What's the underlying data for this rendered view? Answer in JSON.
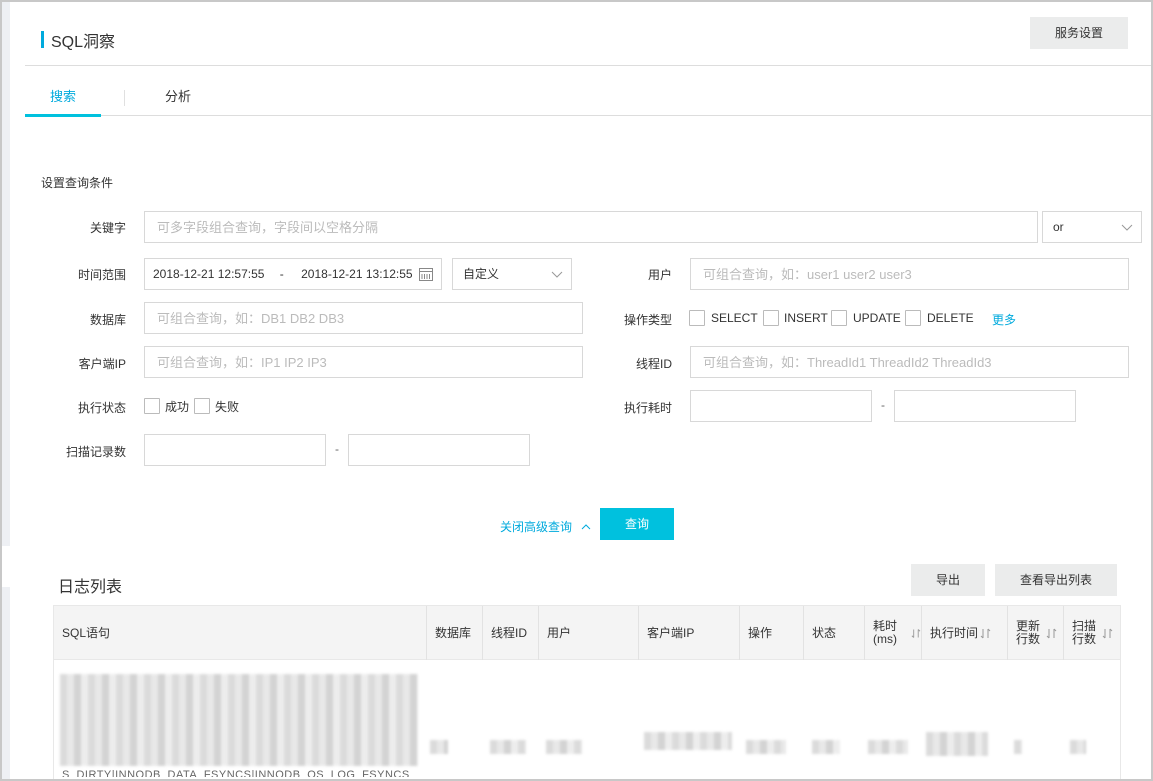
{
  "header": {
    "title": "SQL洞察",
    "service_settings_label": "服务设置"
  },
  "tabs": [
    {
      "label": "搜索",
      "active": true
    },
    {
      "label": "分析",
      "active": false
    }
  ],
  "form": {
    "section_label": "设置查询条件",
    "keyword": {
      "label": "关键字",
      "placeholder": "可多字段组合查询，字段间以空格分隔",
      "value": ""
    },
    "keyword_logic": {
      "selected": "or"
    },
    "time_range": {
      "label": "时间范围",
      "start": "2018-12-21 12:57:55",
      "separator": "-",
      "end": "2018-12-21 13:12:55",
      "preset": "自定义"
    },
    "user": {
      "label": "用户",
      "placeholder": "可组合查询，如：user1 user2 user3",
      "value": ""
    },
    "database": {
      "label": "数据库",
      "placeholder": "可组合查询，如：DB1 DB2 DB3",
      "value": ""
    },
    "operation_type": {
      "label": "操作类型",
      "options": [
        {
          "label": "SELECT",
          "checked": false
        },
        {
          "label": "INSERT",
          "checked": false
        },
        {
          "label": "UPDATE",
          "checked": false
        },
        {
          "label": "DELETE",
          "checked": false
        }
      ],
      "more_label": "更多"
    },
    "client_ip": {
      "label": "客户端IP",
      "placeholder": "可组合查询，如：IP1 IP2 IP3",
      "value": ""
    },
    "thread_id": {
      "label": "线程ID",
      "placeholder": "可组合查询，如：ThreadId1 ThreadId2 ThreadId3",
      "value": ""
    },
    "exec_status": {
      "label": "执行状态",
      "options": [
        {
          "label": "成功",
          "checked": false
        },
        {
          "label": "失败",
          "checked": false
        }
      ]
    },
    "exec_duration": {
      "label": "执行耗时",
      "min": "",
      "max": "",
      "separator": "-"
    },
    "scan_rows": {
      "label": "扫描记录数",
      "min": "",
      "max": "",
      "separator": "-"
    },
    "toggle_advanced_label": "关闭高级查询",
    "query_button_label": "查询"
  },
  "log_list": {
    "title": "日志列表",
    "export_label": "导出",
    "view_export_list_label": "查看导出列表",
    "columns": [
      {
        "label": "SQL语句",
        "sortable": false
      },
      {
        "label": "数据库",
        "sortable": false
      },
      {
        "label": "线程ID",
        "sortable": false
      },
      {
        "label": "用户",
        "sortable": false
      },
      {
        "label": "客户端IP",
        "sortable": false
      },
      {
        "label": "操作",
        "sortable": false
      },
      {
        "label": "状态",
        "sortable": false
      },
      {
        "label": "耗时(ms)",
        "sortable": true
      },
      {
        "label": "执行时间",
        "sortable": true
      },
      {
        "label": "更新行数",
        "sortable": true
      },
      {
        "label": "扫描行数",
        "sortable": true
      }
    ],
    "visible_row_fragment": "S_DIRTY|INNODB_DATA_FSYNCS|INNODB_OS_LOG_FSYNCS"
  },
  "colors": {
    "accent": "#00c1de",
    "link": "#00aadd",
    "gray_button": "#ebecec"
  }
}
